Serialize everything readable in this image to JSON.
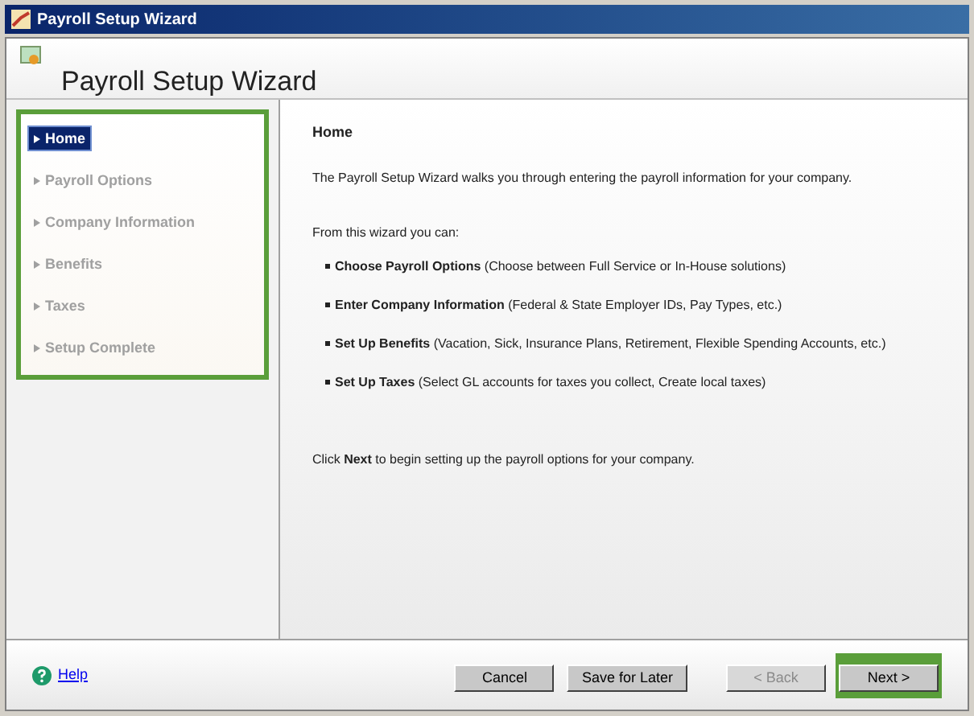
{
  "window": {
    "title": "Payroll Setup Wizard"
  },
  "header": {
    "title": "Payroll Setup Wizard"
  },
  "sidebar": {
    "highlighted": true,
    "items": [
      {
        "label": "Home",
        "selected": true
      },
      {
        "label": "Payroll Options",
        "selected": false
      },
      {
        "label": "Company Information",
        "selected": false
      },
      {
        "label": "Benefits",
        "selected": false
      },
      {
        "label": "Taxes",
        "selected": false
      },
      {
        "label": "Setup Complete",
        "selected": false
      }
    ]
  },
  "content": {
    "heading": "Home",
    "intro": "The Payroll Setup Wizard walks you through entering the payroll information for your company.",
    "list_intro": "From this wizard you can:",
    "bullets": [
      "**Choose Payroll Options** (Choose between Full Service or In-House solutions)",
      "**Enter Company Information** (Federal & State Employer IDs, Pay Types, etc.)",
      "**Set Up Benefits** (Vacation, Sick, Insurance Plans, Retirement, Flexible Spending Accounts, etc.)",
      "**Set Up Taxes** (Select GL accounts for taxes you collect, Create local taxes)"
    ],
    "footer_note": "Click **Next** to begin setting up the payroll options for your company."
  },
  "footer": {
    "help": "Help",
    "buttons": [
      {
        "label": "Cancel",
        "disabled": false,
        "highlighted": false
      },
      {
        "label": "Save for Later",
        "disabled": false,
        "highlighted": false
      },
      {
        "label": "< Back",
        "disabled": true,
        "highlighted": false
      },
      {
        "label": "Next >",
        "disabled": false,
        "highlighted": true
      }
    ]
  }
}
